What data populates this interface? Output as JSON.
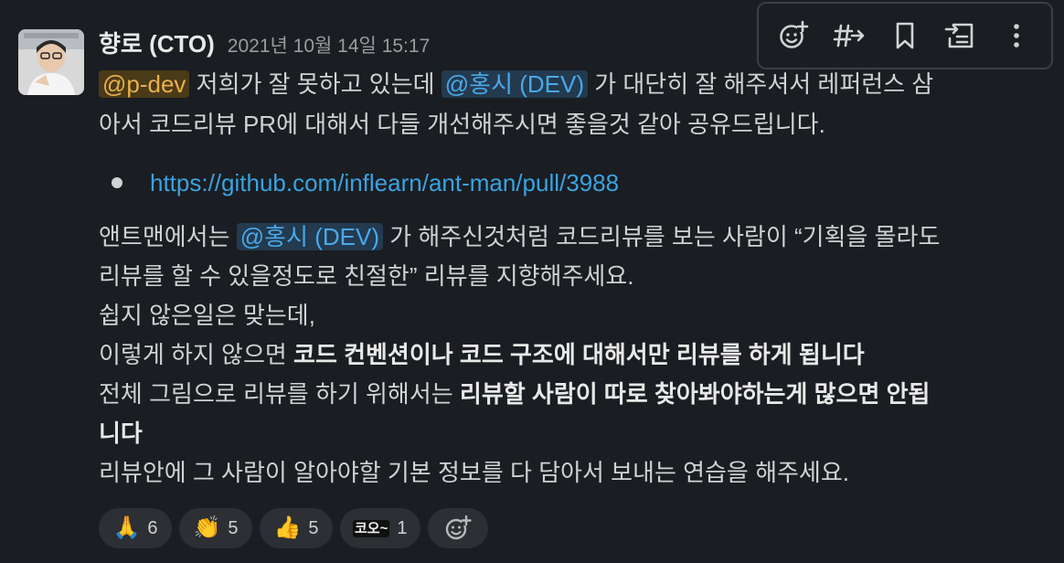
{
  "message": {
    "author": "향로 (CTO)",
    "timestamp": "2021년 10월 14일 15:17",
    "line1": {
      "mention_group": "@p-dev",
      "text_a": " 저희가 잘 못하고 있는데 ",
      "mention_user": "@홍시 (DEV)",
      "text_b": " 가 대단히 잘 해주셔서 레퍼런스 삼"
    },
    "line2": "아서 코드리뷰 PR에 대해서 다들 개선해주시면 좋을것 같아 공유드립니다.",
    "link": "https://github.com/inflearn/ant-man/pull/3988",
    "para2": {
      "line1_a": "앤트맨에서는 ",
      "line1_mention": "@홍시 (DEV)",
      "line1_b": " 가 해주신것처럼 코드리뷰를 보는 사람이 “기획을 몰라도",
      "line2": "리뷰를 할 수 있을정도로 친절한” 리뷰를 지향해주세요.",
      "line3": "쉽지 않은일은 맞는데,",
      "line4_a": "이렇게 하지 않으면 ",
      "line4_bold": "코드 컨벤션이나 코드 구조에 대해서만 리뷰를 하게 됩니다",
      "line5_a": "전체 그림으로 리뷰를 하기 위해서는 ",
      "line5_bold": "리뷰할 사람이 따로 찾아봐야하는게 많으면 안됩",
      "line6_bold": "니다",
      "line7": "리뷰안에 그 사람이 알아야할 기본 정보를 다 담아서 보내는 연습을 해주세요."
    }
  },
  "reactions": [
    {
      "emoji": "🙏",
      "icon": "folded-hands-icon",
      "count": "6"
    },
    {
      "emoji": "👏",
      "icon": "clapping-hands-icon",
      "count": "5"
    },
    {
      "emoji": "👍",
      "icon": "thumbs-up-icon",
      "count": "5"
    },
    {
      "emoji": "코오~",
      "icon": "custom-emoji-icon",
      "count": "1"
    }
  ],
  "toolbar": {
    "icons": [
      "add-reaction-icon",
      "share-to-channel-icon",
      "bookmark-icon",
      "forward-icon",
      "more-actions-icon"
    ]
  },
  "colors": {
    "background": "#1a1d21",
    "mention_user": "#4aa8e8",
    "mention_group": "#e8b04a",
    "link": "#3aa3e3"
  }
}
